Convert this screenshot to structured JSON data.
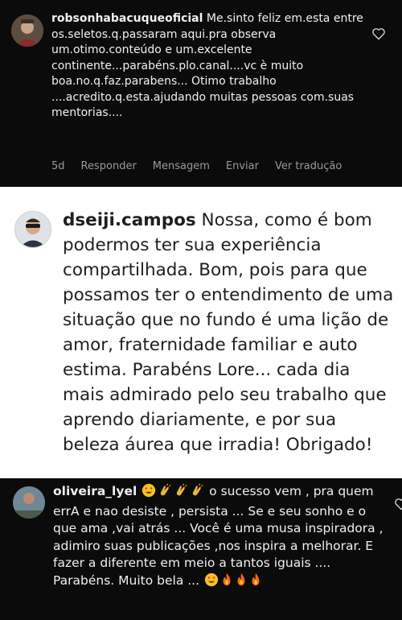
{
  "comments": [
    {
      "username": "robsonhabacuqueoficial",
      "text": " Me.sinto feliz em.esta entre os.seletos.q.passaram aqui.pra observa um.otimo.conteúdo e um.excelente continente...parabéns.plo.canal....vc è muito boa.no.q.faz.parabens... Otimo trabalho ....acredito.q.esta.ajudando muitas pessoas com.suas mentorias....",
      "actions": {
        "age": "5d",
        "reply": "Responder",
        "message": "Mensagem",
        "send": "Enviar",
        "translate": "Ver tradução"
      },
      "icon": "heart-outline-icon"
    },
    {
      "username": "dseiji.campos",
      "text": " Nossa, como é bom podermos ter sua experiência compartilhada. Bom, pois para que possamos ter o entendimento de uma situação que no fundo é uma lição de amor, fraternidade familiar e auto estima. Parabéns Lore... cada dia mais admirado pelo seu trabalho que aprendo diariamente, e por sua beleza áurea que irradia! Obrigado!"
    },
    {
      "username": "oliveira_lyel",
      "text_after_emojis": " o sucesso vem , pra quem errA e nao desiste , persista ... Se e seu sonho e o que ama ,vai atrás ... Você é uma musa inspiradora , adimiro suas publicações ,nos inspira a melhorar. E fazer a diferente em meio a tantos iguais .... Parabéns. Muito bela ...",
      "emojis_start": [
        "heart-eyes-emoji",
        "clapping-hands-emoji",
        "clapping-hands-emoji",
        "clapping-hands-emoji"
      ],
      "emojis_end": [
        "heart-eyes-emoji",
        "fire-emoji",
        "fire-emoji",
        "fire-emoji"
      ],
      "icon": "heart-outline-icon"
    }
  ],
  "colors": {
    "dark_bg": "#0b0b0b",
    "light_bg": "#ffffff",
    "muted": "#9a9a9a",
    "emoji_yellow": "#f7c21b",
    "fire_orange": "#f06a1a"
  }
}
